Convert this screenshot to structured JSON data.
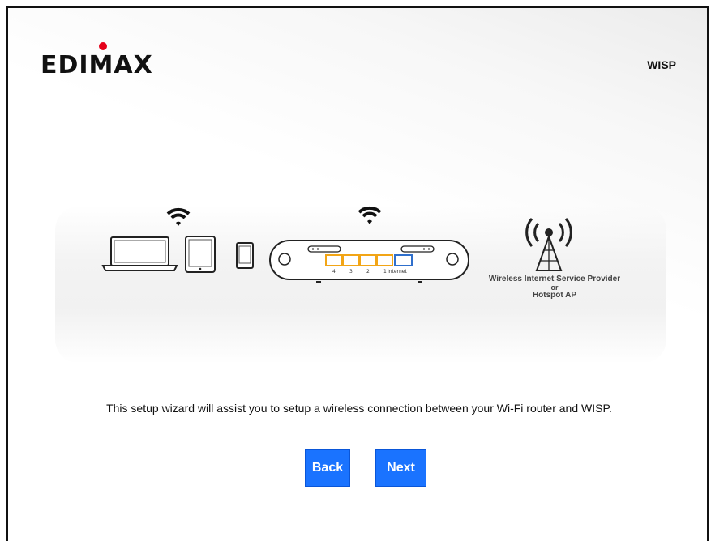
{
  "header": {
    "brand": "EDIMAX",
    "mode": "WISP"
  },
  "illustration": {
    "port_labels": [
      "4",
      "3",
      "2",
      "1",
      "Internet"
    ],
    "caption_line1": "Wireless Internet Service Provider",
    "caption_line2": "or",
    "caption_line3": "Hotspot AP",
    "icons": [
      "wifi-icon",
      "laptop-icon",
      "tablet-icon",
      "smartphone-icon",
      "wifi-icon",
      "router-icon",
      "radio-tower-icon"
    ],
    "colors": {
      "lan_port": "#f2a516",
      "internet_port": "#2f6fcc",
      "logo_dot": "#e5001a"
    }
  },
  "main": {
    "description": "This setup wizard will assist you to setup a wireless connection between your Wi-Fi router and WISP."
  },
  "buttons": {
    "back_label": "Back",
    "next_label": "Next",
    "color": "#1a73ff"
  }
}
